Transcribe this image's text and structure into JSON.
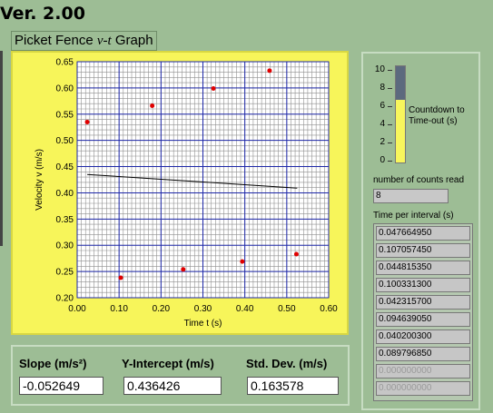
{
  "version": "Ver. 2.00",
  "graph": {
    "title_prefix": "Picket Fence ",
    "title_italic": "v-t",
    "title_suffix": " Graph",
    "colors": {
      "plot_bg": "#f7f55a",
      "grid_major": "#1d27a8",
      "grid_minor": "#8f8f8f",
      "points": "#e00000",
      "fit_line": "#000000"
    }
  },
  "chart_data": {
    "type": "scatter",
    "xlabel": "Time t (s)",
    "ylabel": "Velocity v (m/s)",
    "xlim": [
      0.0,
      0.6
    ],
    "ylim": [
      0.2,
      0.65
    ],
    "x_ticks": [
      "0.00",
      "0.10",
      "0.20",
      "0.30",
      "0.40",
      "0.50",
      "0.60"
    ],
    "y_ticks": [
      "0.20",
      "0.25",
      "0.30",
      "0.35",
      "0.40",
      "0.45",
      "0.50",
      "0.55",
      "0.60",
      "0.65"
    ],
    "grid": true,
    "points": [
      {
        "x": 0.024,
        "y": 0.535
      },
      {
        "x": 0.104,
        "y": 0.238
      },
      {
        "x": 0.179,
        "y": 0.566
      },
      {
        "x": 0.253,
        "y": 0.254
      },
      {
        "x": 0.325,
        "y": 0.599
      },
      {
        "x": 0.394,
        "y": 0.269
      },
      {
        "x": 0.459,
        "y": 0.633
      },
      {
        "x": 0.523,
        "y": 0.283
      }
    ],
    "fit_line": {
      "x": [
        0.024,
        0.525
      ],
      "y": [
        0.435,
        0.409
      ]
    }
  },
  "fit_results": {
    "slope_label": "Slope (m/s²)",
    "slope_value": "-0.052649",
    "intercept_label": "Y-Intercept (m/s)",
    "intercept_value": "0.436426",
    "stddev_label": "Std. Dev. (m/s)",
    "stddev_value": "0.163578"
  },
  "countdown": {
    "label": "Countdown to Time-out (s)",
    "ticks": [
      "10",
      "8",
      "6",
      "4",
      "2",
      "0"
    ],
    "level_fraction": 0.65
  },
  "counts": {
    "label": "number of counts read",
    "value": "8"
  },
  "intervals": {
    "label": "Time per interval (s)",
    "values": [
      "0.047664950",
      "0.107057450",
      "0.044815350",
      "0.100331300",
      "0.042315700",
      "0.094639050",
      "0.040200300",
      "0.089796850",
      "0.000000000",
      "0.000000000"
    ]
  }
}
